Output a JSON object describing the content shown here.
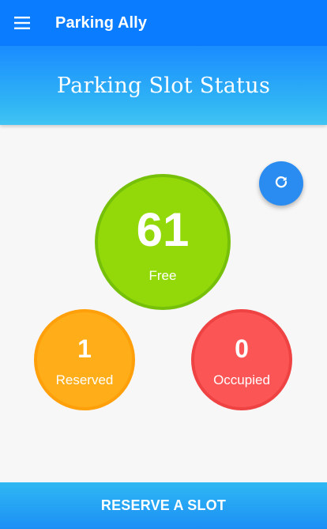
{
  "appbar": {
    "title": "Parking Ally",
    "menu_icon": "hamburger-menu-icon",
    "color": "#0a7cff"
  },
  "hero": {
    "title": "Parking Slot Status"
  },
  "refresh_button": {
    "icon": "refresh-icon",
    "color": "#2a8cf0"
  },
  "status": {
    "free": {
      "count": "61",
      "label": "Free",
      "color": "#93d90a"
    },
    "reserved": {
      "count": "1",
      "label": "Reserved",
      "color": "#ffad18"
    },
    "occupied": {
      "count": "0",
      "label": "Occupied",
      "color": "#fb5555"
    }
  },
  "action": {
    "reserve_label": "RESERVE A SLOT"
  }
}
